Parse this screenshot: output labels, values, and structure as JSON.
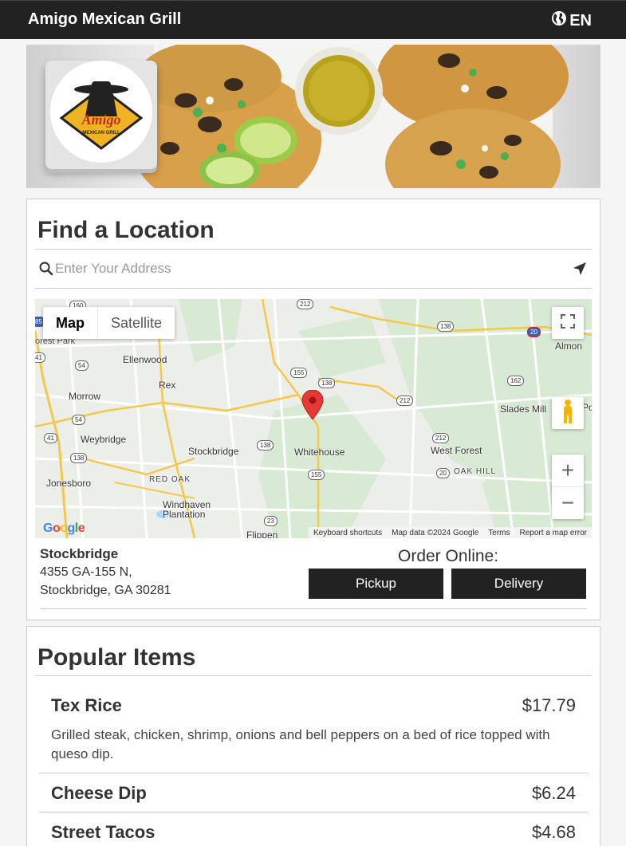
{
  "header": {
    "brand": "Amigo Mexican Grill",
    "language": "EN",
    "globe_icon": "globe-icon",
    "bg_color": "#222222"
  },
  "hero": {
    "logo_text": "Amigo",
    "logo_subtext": "MEXICAN GRILL"
  },
  "find_location": {
    "title": "Find a Location",
    "search_placeholder": "Enter Your Address",
    "search_icon": "search-icon",
    "locate_icon": "location-arrow-icon"
  },
  "map": {
    "type_map": "Map",
    "type_satellite": "Satellite",
    "fullscreen_icon": "fullscreen-icon",
    "pegman_icon": "pegman-icon",
    "zoom_in": "+",
    "zoom_out": "−",
    "google_logo": "Google",
    "footer": {
      "shortcuts": "Keyboard shortcuts",
      "map_data": "Map data ©2024 Google",
      "terms": "Terms",
      "report": "Report a map error"
    },
    "places": [
      "orest Park",
      "Ellenwood",
      "Morrow",
      "Rex",
      "Weybridge",
      "Stockbridge",
      "Whitehouse",
      "West Forest",
      "Slades Mill",
      "Almon",
      "Jonesboro",
      "RED OAK",
      "OAK HILL",
      "Windhaven",
      "Plantation",
      "Flippen",
      "Po"
    ],
    "routes": [
      "160",
      "212",
      "138",
      "20",
      "85",
      "54",
      "155",
      "138",
      "162",
      "212",
      "41",
      "54",
      "138",
      "212",
      "138",
      "155",
      "20",
      "23",
      "41"
    ],
    "marker_color": "#e53935"
  },
  "location": {
    "name": "Stockbridge",
    "address_line1": "4355 GA-155 N,",
    "address_line2": "Stockbridge, GA 30281",
    "order_label": "Order Online:",
    "pickup": "Pickup",
    "delivery": "Delivery"
  },
  "popular": {
    "title": "Popular Items",
    "items": [
      {
        "name": "Tex Rice",
        "price": "$17.79",
        "description": "Grilled steak, chicken, shrimp, onions and bell peppers on a bed of rice topped with queso dip."
      },
      {
        "name": "Cheese Dip",
        "price": "$6.24"
      },
      {
        "name": "Street Tacos",
        "price": "$4.68"
      }
    ]
  }
}
